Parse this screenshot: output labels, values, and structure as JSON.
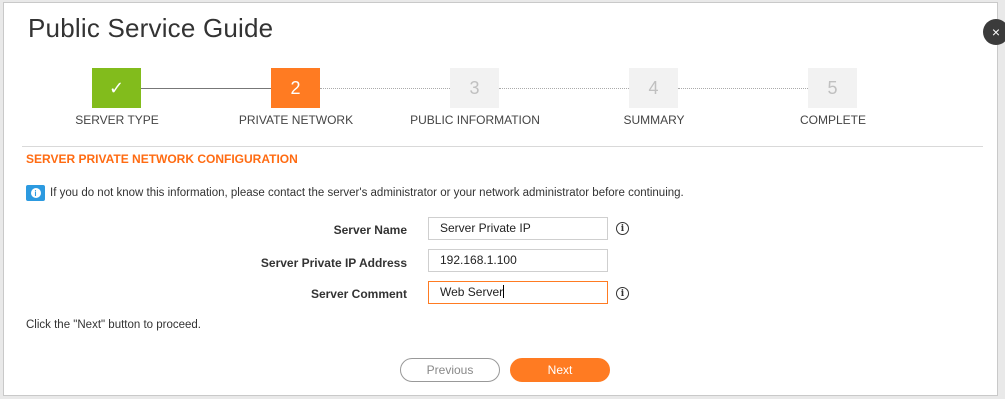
{
  "dialog": {
    "title": "Public Service Guide",
    "close_label": "×"
  },
  "steps": [
    {
      "number": "✓",
      "label": "SERVER TYPE",
      "state": "done"
    },
    {
      "number": "2",
      "label": "PRIVATE NETWORK",
      "state": "active"
    },
    {
      "number": "3",
      "label": "PUBLIC INFORMATION",
      "state": "pending"
    },
    {
      "number": "4",
      "label": "SUMMARY",
      "state": "pending"
    },
    {
      "number": "5",
      "label": "COMPLETE",
      "state": "pending"
    }
  ],
  "section": {
    "title": "SERVER PRIVATE NETWORK CONFIGURATION",
    "info_text": "If you do not know this information, please contact the server's administrator or your network administrator before continuing."
  },
  "form": {
    "server_name_label": "Server Name",
    "server_name_value": "Server Private IP",
    "server_ip_label": "Server Private IP Address",
    "server_ip_value": "192.168.1.100",
    "server_comment_label": "Server Comment",
    "server_comment_value": "Web Server",
    "help_glyph": "i"
  },
  "hint": "Click the \"Next\" button to proceed.",
  "buttons": {
    "previous": "Previous",
    "next": "Next"
  },
  "colors": {
    "accent": "#ff7b22",
    "done": "#82bc1c",
    "info": "#2c9ae0"
  }
}
